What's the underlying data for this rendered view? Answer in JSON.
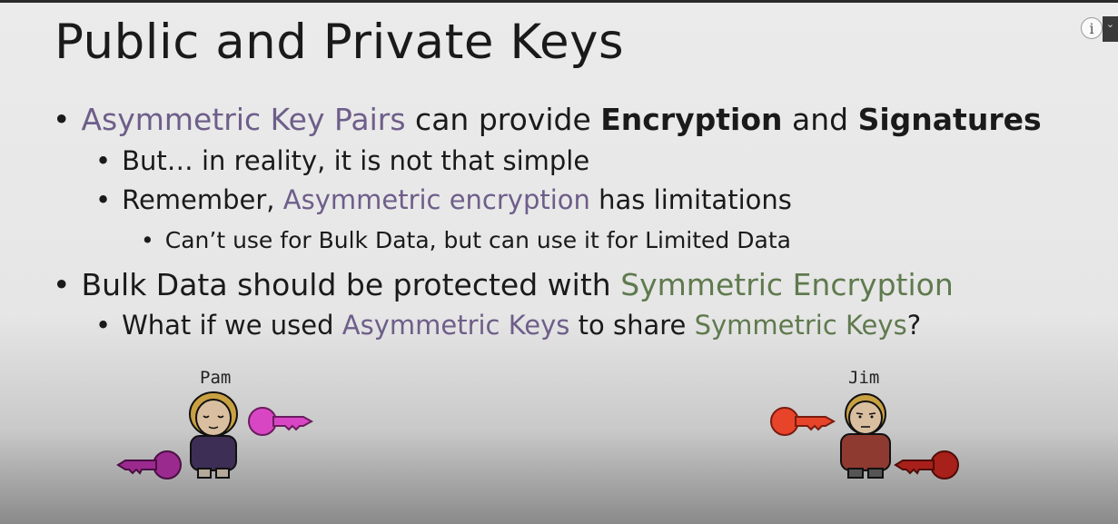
{
  "title": "Public and Private Keys",
  "bullets": {
    "b1": {
      "bullet": "•",
      "part1": "Asymmetric Key Pairs",
      "part2": " can provide ",
      "part3": "Encryption",
      "part4": " and ",
      "part5": "Signatures"
    },
    "b1_1": {
      "bullet": "•",
      "text": "But… in reality, it is not that simple"
    },
    "b1_2": {
      "bullet": "•",
      "part1": "Remember, ",
      "part2": "Asymmetric encryption",
      "part3": " has limitations"
    },
    "b1_2_1": {
      "bullet": "•",
      "text": "Can’t use for Bulk Data, but can use it for Limited Data"
    },
    "b2": {
      "bullet": "•",
      "part1": "Bulk Data should be protected with ",
      "part2": "Symmetric Encryption"
    },
    "b2_1": {
      "bullet": "•",
      "part1": "What if we used ",
      "part2": "Asymmetric Keys",
      "part3": " to share ",
      "part4": "Symmetric Keys",
      "part5": "?"
    }
  },
  "characters": {
    "pam": {
      "name": "Pam"
    },
    "jim": {
      "name": "Jim"
    }
  },
  "colors": {
    "asymmetric_text": "#6e5e8a",
    "symmetric_text": "#5f7a4e",
    "pam_public_key": "#d946c4",
    "pam_private_key": "#9b2a8e",
    "jim_public_key": "#e8442a",
    "jim_private_key": "#a8201a"
  },
  "icons": [
    "info-icon",
    "chevron-down-icon",
    "key-icon"
  ]
}
